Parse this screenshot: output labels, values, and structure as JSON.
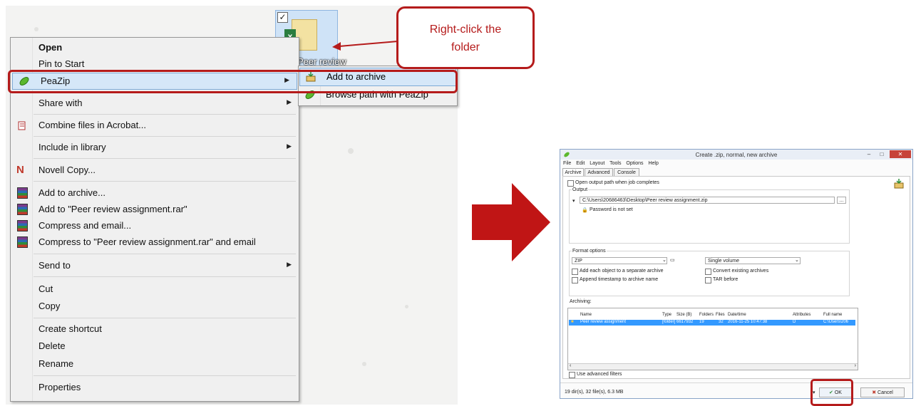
{
  "folder": {
    "label": "Peer review"
  },
  "context_menu": {
    "items": [
      {
        "label": "Open"
      },
      {
        "label": "Pin to Start"
      },
      {
        "label": "PeaZip"
      },
      {
        "label": "Share with"
      },
      {
        "label": "Combine files in Acrobat..."
      },
      {
        "label": "Include in library"
      },
      {
        "label": "Novell Copy..."
      },
      {
        "label": "Add to archive..."
      },
      {
        "label": "Add to \"Peer review assignment.rar\""
      },
      {
        "label": "Compress and email..."
      },
      {
        "label": "Compress to \"Peer review assignment.rar\" and email"
      },
      {
        "label": "Send to"
      },
      {
        "label": "Cut"
      },
      {
        "label": "Copy"
      },
      {
        "label": "Create shortcut"
      },
      {
        "label": "Delete"
      },
      {
        "label": "Rename"
      },
      {
        "label": "Properties"
      }
    ]
  },
  "submenu": {
    "items": [
      {
        "label": "Add to archive"
      },
      {
        "label": "Browse path with PeaZip"
      }
    ]
  },
  "callout": {
    "line1": "Right-click the",
    "line2": "folder"
  },
  "peazip": {
    "title": "Create .zip, normal, new archive",
    "menu": [
      "File",
      "Edit",
      "Layout",
      "Tools",
      "Options",
      "Help"
    ],
    "tabs": [
      "Archive",
      "Advanced",
      "Console"
    ],
    "open_output_label": "Open output path when job completes",
    "output_label": "Output",
    "output_path": "C:\\Users\\20686463\\Desktop\\Peer review assignment.zip",
    "browse_label": "...",
    "password_label": "Password is not set",
    "format_options_label": "Format options",
    "format": "ZIP",
    "volume": "Single volume",
    "opt_separate": "Add each object to a separate archive",
    "opt_convert": "Convert existing archives",
    "opt_timestamp": "Append timestamp to archive name",
    "opt_tar": "TAR before",
    "archiving_label": "Archiving:",
    "columns": [
      "Name",
      "Type",
      "Size (B)",
      "Folders",
      "Files",
      "Date/time",
      "Attributes",
      "Full name"
    ],
    "row": {
      "name": "Peer review assignment",
      "type": "[folder]",
      "size": "6617932",
      "folders": "19",
      "files": "32",
      "datetime": "2016-11-25 10:47:38",
      "attributes": "D",
      "fullname": "C:\\Users\\206"
    },
    "advanced_filters_label": "Use advanced filters",
    "status": "19 dir(s), 32 file(s), 6.3 MB",
    "ok_label": "OK",
    "cancel_label": "Cancel"
  },
  "colors": {
    "annotation_red": "#b51b1b",
    "highlight": "#d5e7f8",
    "selection": "#3399ff"
  }
}
